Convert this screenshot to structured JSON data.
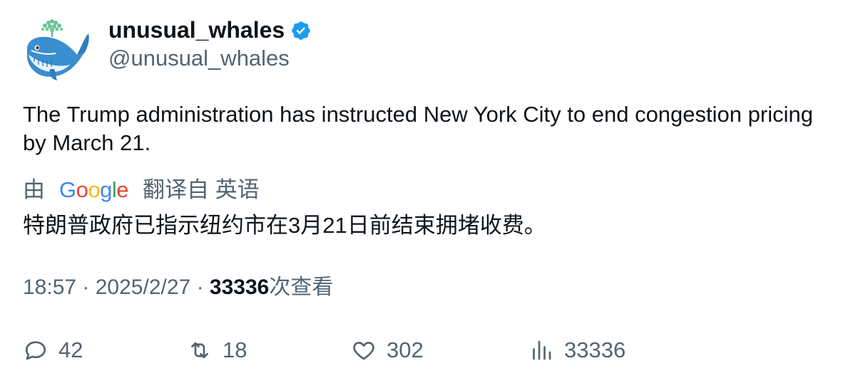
{
  "author": {
    "display_name": "unusual_whales",
    "handle": "@unusual_whales",
    "verified": true,
    "verified_color": "#1d9bf0",
    "avatar_icon": "whale-avatar-icon"
  },
  "tweet": {
    "text": "The Trump administration has instructed New York City to end congestion pricing by March 21.",
    "translation": {
      "prefix": "由",
      "provider": "Google",
      "suffix": "翻译自 英语",
      "text": "特朗普政府已指示纽约市在3月21日前结束拥堵收费。"
    }
  },
  "meta": {
    "time": "18:57",
    "separator": "·",
    "date": "2025/2/27",
    "views_count": "33336",
    "views_label": "次查看"
  },
  "actions": {
    "replies": "42",
    "retweets": "18",
    "likes": "302",
    "views": "33336"
  },
  "colors": {
    "text_primary": "#0f1419",
    "text_secondary": "#536471",
    "google_blue": "#4285F4",
    "google_red": "#EA4335",
    "google_yellow": "#FBBC05",
    "google_green": "#34A853"
  }
}
